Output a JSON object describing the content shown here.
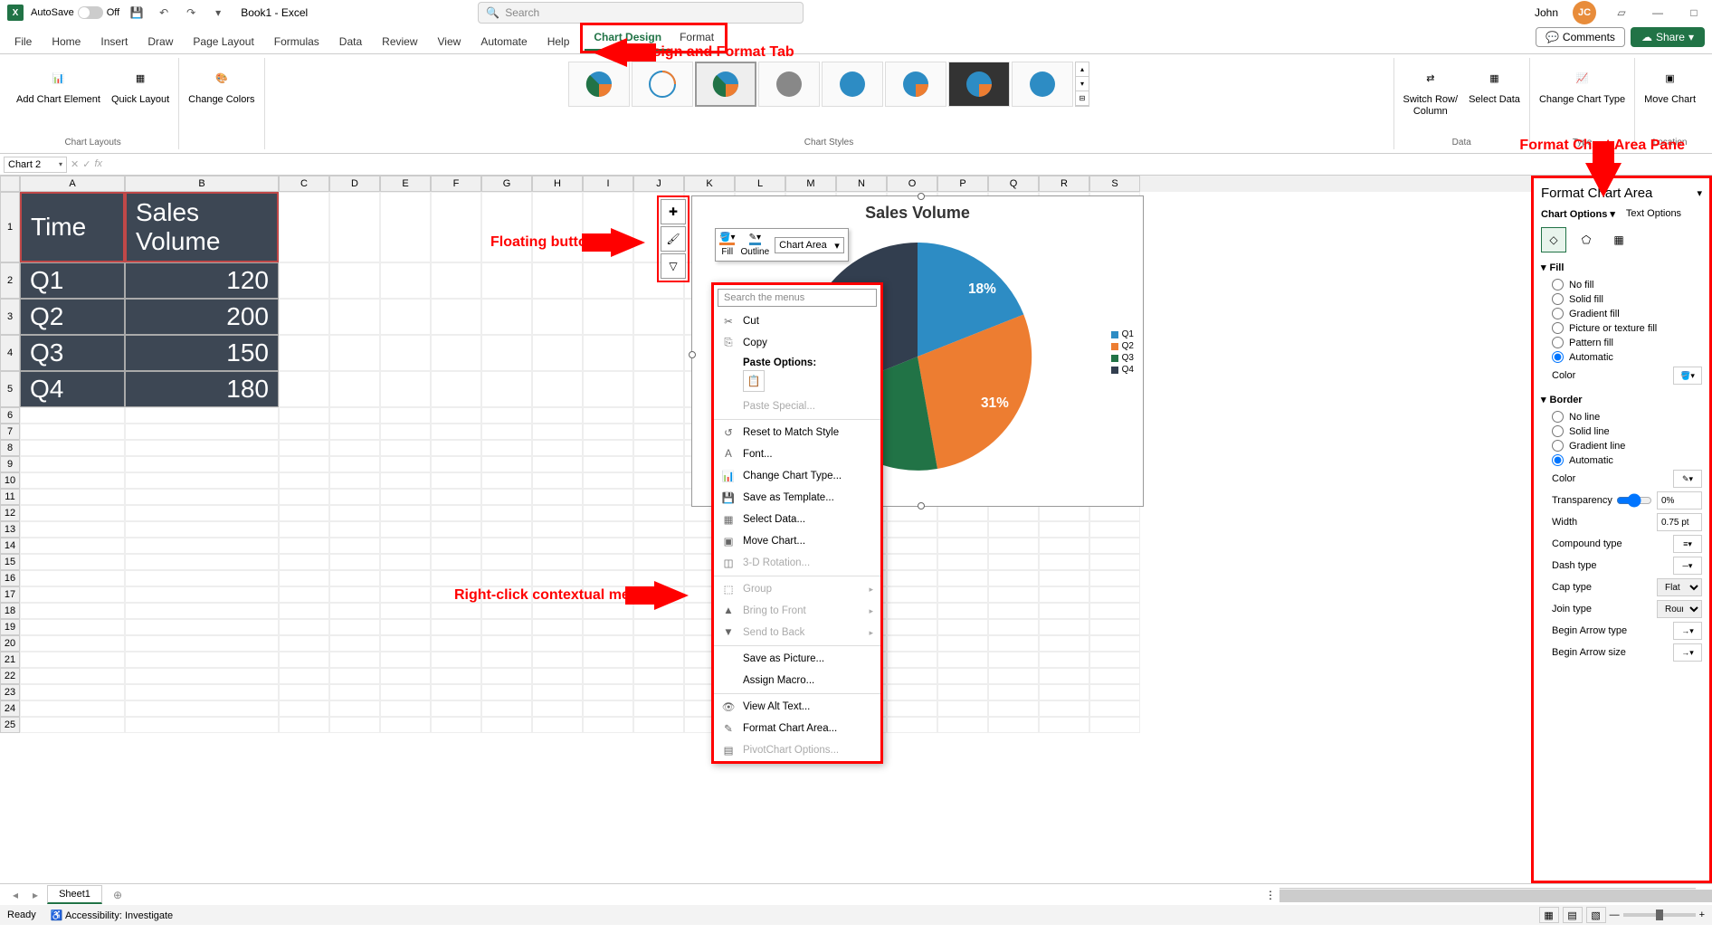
{
  "title_bar": {
    "autosave_label": "AutoSave",
    "autosave_state": "Off",
    "doc_title": "Book1 - Excel",
    "search_placeholder": "Search",
    "user_name": "John",
    "user_initials": "JC"
  },
  "tabs": {
    "items": [
      "File",
      "Home",
      "Insert",
      "Draw",
      "Page Layout",
      "Formulas",
      "Data",
      "Review",
      "View",
      "Automate",
      "Help",
      "Chart Design",
      "Format"
    ],
    "active": "Chart Design",
    "comments_btn": "Comments",
    "share_btn": "Share"
  },
  "ribbon": {
    "groups": {
      "chart_layouts": {
        "label": "Chart Layouts",
        "add_element": "Add Chart Element",
        "quick_layout": "Quick Layout"
      },
      "change_colors": "Change Colors",
      "chart_styles": {
        "label": "Chart Styles"
      },
      "data": {
        "label": "Data",
        "switch": "Switch Row/\nColumn",
        "select": "Select Data"
      },
      "type": {
        "label": "Type",
        "change": "Change Chart Type"
      },
      "location": {
        "label": "Location",
        "move": "Move Chart"
      }
    }
  },
  "name_box": "Chart 2",
  "annotations": {
    "design_format": "Design and Format Tab",
    "floating": "Floating buttons",
    "context": "Right-click contextual menu",
    "pane": "Format Chart Area Pane"
  },
  "spreadsheet": {
    "columns": [
      "A",
      "B",
      "C",
      "D",
      "E",
      "F",
      "G",
      "H",
      "I",
      "J",
      "K",
      "L",
      "M",
      "N",
      "O",
      "P",
      "Q",
      "R",
      "S"
    ],
    "row_count": 25,
    "headers": [
      "Time",
      "Sales Volume"
    ],
    "rows": [
      [
        "Q1",
        "120"
      ],
      [
        "Q2",
        "200"
      ],
      [
        "Q3",
        "150"
      ],
      [
        "Q4",
        "180"
      ]
    ]
  },
  "chart": {
    "title": "Sales Volume",
    "legend": [
      "Q1",
      "Q2",
      "Q3",
      "Q4"
    ],
    "labels": [
      "18%",
      "31%"
    ],
    "colors": [
      "#2d8cc4",
      "#ed7d31",
      "#217346",
      "#323e4f"
    ]
  },
  "chart_data": {
    "type": "pie",
    "title": "Sales Volume",
    "categories": [
      "Q1",
      "Q2",
      "Q3",
      "Q4"
    ],
    "values": [
      120,
      200,
      150,
      180
    ],
    "percentages": [
      18,
      31,
      23,
      28
    ],
    "colors": [
      "#2d8cc4",
      "#ed7d31",
      "#217346",
      "#323e4f"
    ]
  },
  "mini_toolbar": {
    "fill": "Fill",
    "outline": "Outline",
    "area": "Chart Area"
  },
  "context_menu": {
    "search": "Search the menus",
    "items": [
      {
        "icon": "cut",
        "label": "Cut",
        "enabled": true
      },
      {
        "icon": "copy",
        "label": "Copy",
        "enabled": true
      },
      {
        "header": "Paste Options:"
      },
      {
        "paste_opt": true
      },
      {
        "icon": "",
        "label": "Paste Special...",
        "enabled": false
      },
      {
        "sep": true
      },
      {
        "icon": "reset",
        "label": "Reset to Match Style",
        "enabled": true
      },
      {
        "icon": "font",
        "label": "Font...",
        "enabled": true
      },
      {
        "icon": "chart",
        "label": "Change Chart Type...",
        "enabled": true
      },
      {
        "icon": "template",
        "label": "Save as Template...",
        "enabled": true
      },
      {
        "icon": "select",
        "label": "Select Data...",
        "enabled": true
      },
      {
        "icon": "move",
        "label": "Move Chart...",
        "enabled": true
      },
      {
        "icon": "3d",
        "label": "3-D Rotation...",
        "enabled": false
      },
      {
        "sep": true
      },
      {
        "icon": "group",
        "label": "Group",
        "enabled": false,
        "sub": true
      },
      {
        "icon": "front",
        "label": "Bring to Front",
        "enabled": false,
        "sub": true
      },
      {
        "icon": "back",
        "label": "Send to Back",
        "enabled": false,
        "sub": true
      },
      {
        "sep": true
      },
      {
        "icon": "",
        "label": "Save as Picture...",
        "enabled": true
      },
      {
        "icon": "",
        "label": "Assign Macro...",
        "enabled": true
      },
      {
        "sep": true
      },
      {
        "icon": "alt",
        "label": "View Alt Text...",
        "enabled": true
      },
      {
        "icon": "format",
        "label": "Format Chart Area...",
        "enabled": true
      },
      {
        "icon": "pivot",
        "label": "PivotChart Options...",
        "enabled": false
      }
    ]
  },
  "format_pane": {
    "title": "Format Chart Area",
    "tab_chart": "Chart Options",
    "tab_text": "Text Options",
    "fill": {
      "header": "Fill",
      "options": [
        "No fill",
        "Solid fill",
        "Gradient fill",
        "Picture or texture fill",
        "Pattern fill",
        "Automatic"
      ],
      "selected": "Automatic",
      "color_label": "Color"
    },
    "border": {
      "header": "Border",
      "options": [
        "No line",
        "Solid line",
        "Gradient line",
        "Automatic"
      ],
      "selected": "Automatic",
      "color_label": "Color",
      "transparency_label": "Transparency",
      "transparency_value": "0%",
      "width_label": "Width",
      "width_value": "0.75 pt",
      "compound_label": "Compound type",
      "dash_label": "Dash type",
      "cap_label": "Cap type",
      "cap_value": "Flat",
      "join_label": "Join type",
      "join_value": "Round",
      "begin_arrow_label": "Begin Arrow type",
      "begin_arrow_size_label": "Begin Arrow size"
    }
  },
  "sheet_tab": "Sheet1",
  "status": {
    "ready": "Ready",
    "accessibility": "Accessibility: Investigate"
  }
}
